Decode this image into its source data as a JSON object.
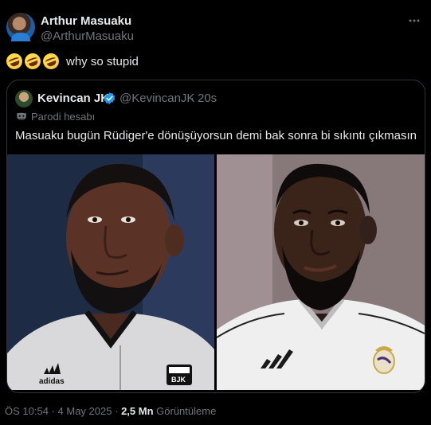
{
  "tweet": {
    "author_name": "Arthur Masuaku",
    "author_handle": "@ArthurMasuaku",
    "more_icon": "more-icon",
    "text": "why so stupid",
    "emoji_count": 3,
    "emoji_name": "rolling-on-floor-laughing-emoji"
  },
  "quote": {
    "author_name": "Kevincan JK",
    "author_handle": "@KevincanJK",
    "separator": "·",
    "time": "20s",
    "verified_icon": "verified-badge-icon",
    "parody_label": "Parodi hesabı",
    "text": "Masuaku bugün Rüdiger'e dönüşüyorsun demi bak sonra bi sıkıntı çıkmasın",
    "images": [
      {
        "name": "photo-left",
        "shirt_text": "adidas",
        "crest": "BJK"
      },
      {
        "name": "photo-right",
        "shirt_text": "",
        "crest": ""
      }
    ]
  },
  "meta": {
    "time": "ÖS 10:54",
    "separator": "·",
    "date": "4 May 2025",
    "separator2": "·",
    "views_count": "2,5 Mn",
    "views_label": "Görüntüleme"
  },
  "colors": {
    "background": "#000000",
    "text": "#e7e9ea",
    "muted": "#71767b",
    "border": "#2f3336",
    "verified": "#1d9bf0"
  }
}
